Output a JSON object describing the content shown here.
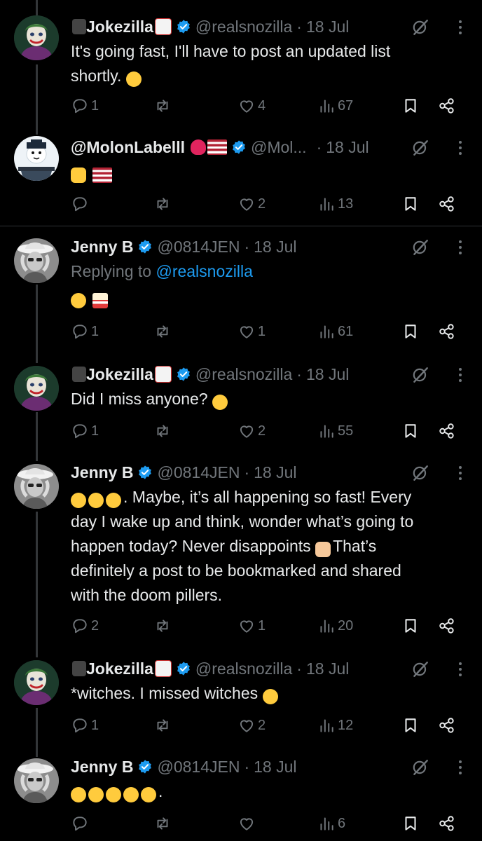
{
  "tweets": [
    {
      "name": "Jokezilla",
      "handle": "@realsnozilla",
      "separator": "·",
      "date": "18 Jul",
      "lines": [
        "It's going fast, I'll have to post an updated list",
        "shortly."
      ],
      "replies": "1",
      "likes": "4",
      "views": "67"
    },
    {
      "name": "@MolonLabelll",
      "handle": "@Mol...",
      "separator": "·",
      "date": "18 Jul",
      "lines": [
        ""
      ],
      "replies": "",
      "likes": "2",
      "views": "13"
    },
    {
      "name": "Jenny B",
      "handle": "@0814JEN",
      "separator": "·",
      "date": "18 Jul",
      "replying_prefix": "Replying to",
      "replying_to": "@realsnozilla",
      "lines": [
        ""
      ],
      "replies": "1",
      "likes": "1",
      "views": "61"
    },
    {
      "name": "Jokezilla",
      "handle": "@realsnozilla",
      "separator": "·",
      "date": "18 Jul",
      "lines": [
        "Did I miss anyone?"
      ],
      "replies": "1",
      "likes": "2",
      "views": "55"
    },
    {
      "name": "Jenny B",
      "handle": "@0814JEN",
      "separator": "·",
      "date": "18 Jul",
      "lines": [
        ". Maybe, it’s all happening so fast!  Every",
        "day I wake up and think, wonder what’s going to",
        "happen today?  Never disappoints ",
        "That’s",
        "definitely a post to be bookmarked and shared",
        "with the doom pillers."
      ],
      "replies": "2",
      "likes": "1",
      "views": "20"
    },
    {
      "name": "Jokezilla",
      "handle": "@realsnozilla",
      "separator": "·",
      "date": "18 Jul",
      "lines": [
        "*witches. I missed witches"
      ],
      "replies": "1",
      "likes": "2",
      "views": "12"
    },
    {
      "name": "Jenny B",
      "handle": "@0814JEN",
      "separator": "·",
      "date": "18 Jul",
      "lines": [
        "."
      ],
      "replies": "",
      "likes": "",
      "views": "6"
    }
  ],
  "colors": {
    "background": "#000000",
    "text": "#e7e9ea",
    "muted": "#71767b",
    "link": "#1d9bf0",
    "verified": "#1d9bf0"
  },
  "icons": [
    "reply-icon",
    "retweet-icon",
    "like-icon",
    "views-icon",
    "bookmark-icon",
    "share-icon",
    "grok-icon",
    "more-icon",
    "verified-badge-icon"
  ]
}
